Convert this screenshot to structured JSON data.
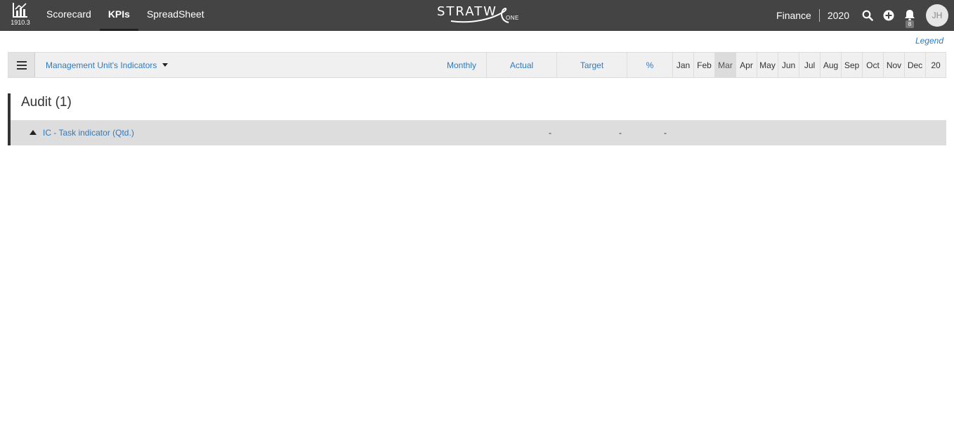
{
  "app": {
    "version": "1910.3",
    "brand": "STRATW",
    "brand_sub": "ONE"
  },
  "nav": {
    "items": [
      {
        "label": "Scorecard",
        "active": false
      },
      {
        "label": "KPIs",
        "active": true
      },
      {
        "label": "SpreadSheet",
        "active": false
      }
    ]
  },
  "context": {
    "unit": "Finance",
    "year": "2020"
  },
  "notifications": {
    "count": "8"
  },
  "user": {
    "initials": "JH"
  },
  "legend_label": "Legend",
  "header": {
    "unit_selector": "Management Unit's Indicators",
    "frequency": "Monthly",
    "actual": "Actual",
    "target": "Target",
    "percent": "%",
    "months": [
      "Jan",
      "Feb",
      "Mar",
      "Apr",
      "May",
      "Jun",
      "Jul",
      "Aug",
      "Sep",
      "Oct",
      "Nov",
      "Dec",
      "20"
    ],
    "current_month": "Mar"
  },
  "groups": [
    {
      "title": "Audit (1)",
      "indicators": [
        {
          "name": "IC - Task indicator (Qtd.)",
          "actual": "-",
          "target": "-",
          "percent": "-"
        }
      ]
    }
  ],
  "colors": {
    "topbar": "#444444",
    "link": "#2e7bbf",
    "row_bg": "#dddddd"
  }
}
